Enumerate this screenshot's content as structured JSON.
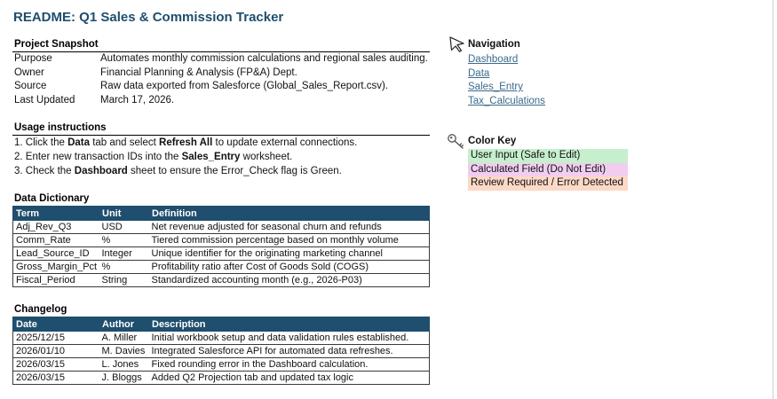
{
  "title": "README: Q1 Sales & Commission Tracker",
  "project_snapshot": {
    "heading": "Project Snapshot",
    "rows": [
      {
        "key": "Purpose",
        "value": "Automates monthly commission calculations and regional sales auditing."
      },
      {
        "key": "Owner",
        "value": "Financial Planning & Analysis (FP&A) Dept."
      },
      {
        "key": "Source",
        "value": "Raw data exported from Salesforce (Global_Sales_Report.csv)."
      },
      {
        "key": "Last Updated",
        "value": "March 17, 2026."
      }
    ]
  },
  "usage": {
    "heading": "Usage instructions",
    "lines": [
      {
        "p1": "1. Click the ",
        "b1": "Data",
        "p2": " tab and select ",
        "b2": "Refresh All",
        "p3": " to update external connections."
      },
      {
        "p1": "2. Enter new transaction IDs into the ",
        "b1": "Sales_Entry",
        "p2": " worksheet.",
        "b2": "",
        "p3": ""
      },
      {
        "p1": "3. Check the ",
        "b1": "Dashboard",
        "p2": " sheet to ensure the Error_Check flag is Green.",
        "b2": "",
        "p3": ""
      }
    ]
  },
  "data_dictionary": {
    "heading": "Data Dictionary",
    "columns": [
      "Term",
      "Unit",
      "Definition"
    ],
    "rows": [
      [
        "Adj_Rev_Q3",
        "USD",
        "Net revenue adjusted for seasonal churn and refunds"
      ],
      [
        "Comm_Rate",
        "%",
        "Tiered commission percentage based on monthly volume"
      ],
      [
        "Lead_Source_ID",
        "Integer",
        "Unique identifier for the originating marketing channel"
      ],
      [
        "Gross_Margin_Pct",
        "%",
        "Profitability ratio after Cost of Goods Sold (COGS)"
      ],
      [
        "Fiscal_Period",
        "String",
        "Standardized accounting month (e.g., 2026-P03)"
      ]
    ]
  },
  "changelog": {
    "heading": "Changelog",
    "columns": [
      "Date",
      "Author",
      "Description"
    ],
    "rows": [
      [
        "2025/12/15",
        "A. Miller",
        "Initial workbook setup and data validation rules established."
      ],
      [
        "2026/01/10",
        "M. Davies",
        "Integrated Salesforce API for automated data refreshes."
      ],
      [
        "2026/03/15",
        "L. Jones",
        "Fixed rounding error in the Dashboard calculation."
      ],
      [
        "2026/03/15",
        "J. Bloggs",
        "Added Q2 Projection tab and updated tax logic"
      ]
    ]
  },
  "navigation": {
    "heading": "Navigation",
    "icon": "cursor-arrow-icon",
    "links": [
      "Dashboard",
      "Data",
      "Sales_Entry",
      "Tax_Calculations"
    ]
  },
  "color_key": {
    "heading": "Color Key",
    "icon": "key-icon",
    "items": [
      {
        "label": "User Input (Safe to Edit)",
        "color": "#c6efce"
      },
      {
        "label": "Calculated Field (Do Not Edit)",
        "color": "#f2cdf0"
      },
      {
        "label": "Review Required / Error Detected",
        "color": "#fbd9c6"
      }
    ]
  },
  "colors": {
    "header_bg": "#1f4e6e",
    "title_color": "#1f4e6e",
    "link_color": "#3a6b8a"
  }
}
